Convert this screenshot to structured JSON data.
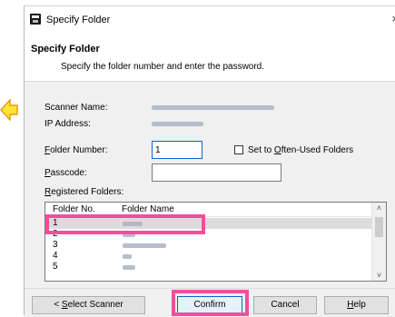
{
  "colors": {
    "highlight": "#ef4f9c",
    "arrow_fill": "#ffe633",
    "arrow_stroke": "#e08a00",
    "window_bg": "#f0f0f0",
    "accent": "#0a64c8"
  },
  "window": {
    "title": "Specify Folder",
    "icon": "app-icon"
  },
  "header": {
    "title": "Specify Folder",
    "description": "Specify the folder number and enter the password."
  },
  "form": {
    "scanner_name_label": "Scanner Name:",
    "ip_address_label": "IP Address:",
    "folder_number_label_pre": "",
    "folder_number_label_ul": "F",
    "folder_number_label_post": "older Number:",
    "folder_number_value": "1",
    "often_used_pre": "Set to ",
    "often_used_ul": "O",
    "often_used_post": "ften-Used Folders",
    "passcode_ul": "P",
    "passcode_post": "asscode:",
    "passcode_value": "",
    "registered_ul": "R",
    "registered_post": "egistered Folders:"
  },
  "table": {
    "columns": [
      "Folder No.",
      "Folder Name"
    ],
    "rows": [
      {
        "no": "1",
        "selected": true
      },
      {
        "no": "2",
        "selected": false
      },
      {
        "no": "3",
        "selected": false
      },
      {
        "no": "4",
        "selected": false
      },
      {
        "no": "5",
        "selected": false
      }
    ]
  },
  "buttons": {
    "select_scanner_pre": "< ",
    "select_scanner_ul": "S",
    "select_scanner_post": "elect Scanner",
    "confirm": "Confirm",
    "cancel": "Cancel",
    "help_ul": "H",
    "help_post": "elp"
  },
  "icons": {
    "close": "×",
    "scroll_up": "˄",
    "scroll_down": "˅"
  }
}
